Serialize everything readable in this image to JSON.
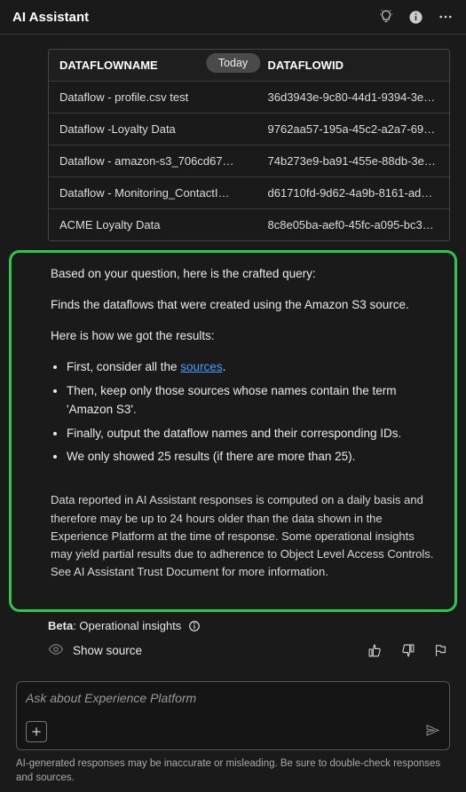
{
  "header": {
    "title": "AI Assistant"
  },
  "date_label": "Today",
  "table": {
    "headers": [
      "DATAFLOWNAME",
      "DATAFLOWID"
    ],
    "rows": [
      [
        "Dataflow - profile.csv test",
        "36d3943e-9c80-44d1-9394-3e9…"
      ],
      [
        "Dataflow -Loyalty Data",
        "9762aa57-195a-45c2-a2a7-696b…"
      ],
      [
        "Dataflow - amazon-s3_706cd67…",
        "74b273e9-ba91-455e-88db-3e33…"
      ],
      [
        "Dataflow - Monitoring_ContactI…",
        "d61710fd-9d62-4a9b-8161-ad6ef…"
      ],
      [
        "ACME Loyalty Data",
        "8c8e05ba-aef0-45fc-a095-bc3b…"
      ]
    ]
  },
  "answer": {
    "intro": "Based on your question, here is the crafted query:",
    "summary": "Finds the dataflows that were created using the Amazon S3 source.",
    "how": "Here is how we got the results:",
    "step1_pre": "First, consider all the ",
    "step1_link": "sources",
    "step1_post": ".",
    "step2": "Then, keep only those sources whose names contain the term 'Amazon S3'.",
    "step3": "Finally, output the dataflow names and their corresponding IDs.",
    "step4": "We only showed 25 results (if there are more than 25).",
    "disclaimer": "Data reported in AI Assistant responses is computed on a daily basis and therefore may be up to 24 hours older than the data shown in the Experience Platform at the time of response. Some operational insights may yield partial results due to adherence to Object Level Access Controls. See AI Assistant Trust Document for more information."
  },
  "meta": {
    "beta_label": "Beta",
    "beta_text": ": Operational insights"
  },
  "source": {
    "label": "Show source"
  },
  "input": {
    "placeholder": "Ask about Experience Platform"
  },
  "footer": "AI-generated responses may be inaccurate or misleading. Be sure to double-check responses and sources."
}
